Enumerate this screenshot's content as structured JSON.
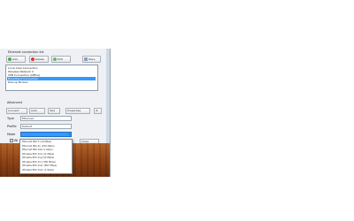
{
  "window": {
    "group_title": "Ethernet connection list",
    "toolbar": {
      "add_label": "Add",
      "remove_label": "Delete",
      "edit_label": "Edit",
      "more_label": "More"
    },
    "list": {
      "rows": [
        "Local Area Connection",
        "Wireless Network 2",
        "VPN Connection (Office)",
        "Broadband Connection",
        "Dial-up Modem"
      ],
      "selected_index": 3
    },
    "settings": {
      "group_title": "Advanced",
      "connect_label": "Connect",
      "speed_value": "Auto",
      "test_label": "Test",
      "properties_label": "Properties",
      "type_label": "Type",
      "type_value": "Ethernet",
      "profile_label": "Profile",
      "profile_value": "Default",
      "mode_label": "Mode",
      "mode_value": "",
      "option_label": "Wi",
      "close_label": "Close"
    },
    "dropdown": {
      "items": [
        "Ethernet 802.3 (10 Mbps)",
        "Ethernet 802.3u (100 Mbps)",
        "Ethernet 802.3ab (1 Gbps)",
        "Wireless 802.11b (11 Mbps)",
        "Wireless 802.11g (54 Mbps)",
        "Wireless 802.11n (300 Mbps)",
        "Wireless 802.11ac (867 Mbps)",
        "Wireless 802.11ax (1 Gbps)"
      ]
    }
  }
}
